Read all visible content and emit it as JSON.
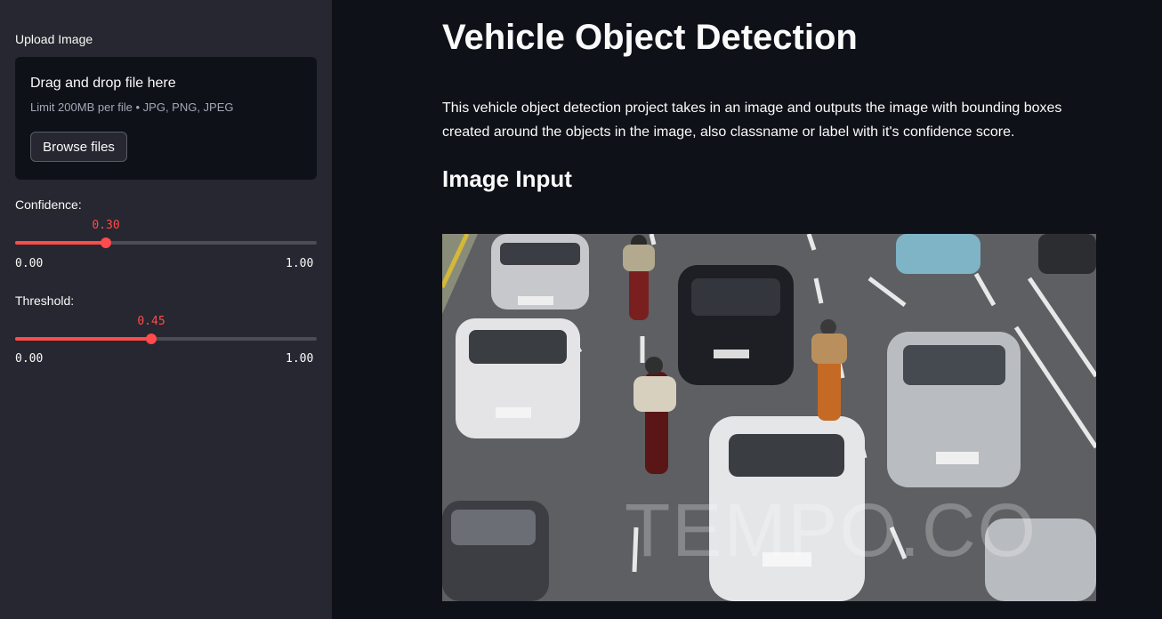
{
  "sidebar": {
    "upload_label": "Upload Image",
    "uploader": {
      "drag_text": "Drag and drop file here",
      "limit_text": "Limit 200MB per file • JPG, PNG, JPEG",
      "browse_label": "Browse files"
    },
    "confidence": {
      "label": "Confidence:",
      "value": "0.30",
      "min": "0.00",
      "max": "1.00",
      "fraction": 0.3
    },
    "threshold": {
      "label": "Threshold:",
      "value": "0.45",
      "min": "0.00",
      "max": "1.00",
      "fraction": 0.45
    }
  },
  "main": {
    "title": "Vehicle Object Detection",
    "description": "This vehicle object detection project takes in an image and outputs the image with bounding boxes created around the objects in the image, also classname or label with it's confidence score.",
    "subheading": "Image Input",
    "image": {
      "watermark": "TEMPO.CO"
    }
  },
  "colors": {
    "accent": "#ff4b4b",
    "sidebar_bg": "#262730",
    "main_bg": "#0e1117",
    "text": "#fafafa"
  }
}
